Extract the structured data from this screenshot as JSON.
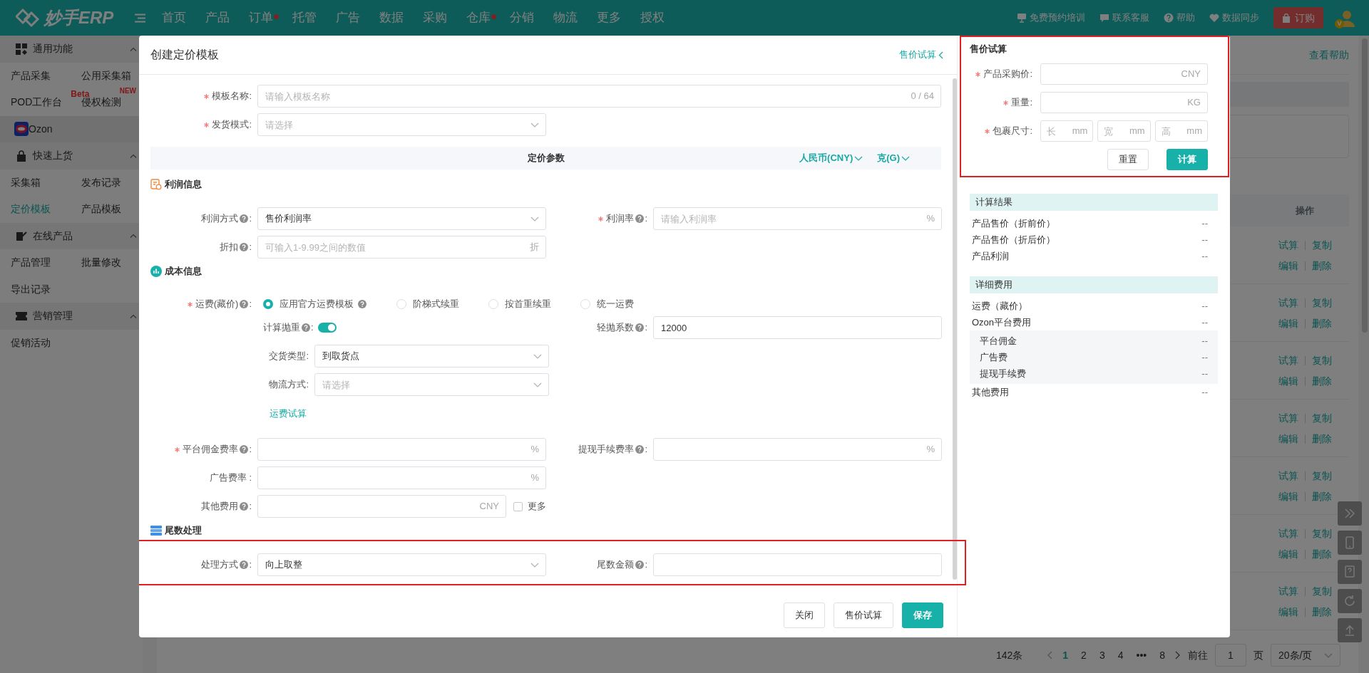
{
  "nav": {
    "logo": "妙手ERP",
    "items": [
      {
        "label": "首页",
        "dot": false
      },
      {
        "label": "产品",
        "dot": false
      },
      {
        "label": "订单",
        "dot": true
      },
      {
        "label": "托管",
        "dot": false
      },
      {
        "label": "广告",
        "dot": false
      },
      {
        "label": "数据",
        "dot": false
      },
      {
        "label": "采购",
        "dot": false
      },
      {
        "label": "仓库",
        "dot": true
      },
      {
        "label": "分销",
        "dot": false
      },
      {
        "label": "物流",
        "dot": false
      },
      {
        "label": "更多",
        "dot": false
      },
      {
        "label": "授权",
        "dot": false
      }
    ],
    "links": [
      "免费预约培训",
      "联系客服",
      "帮助",
      "数据同步"
    ],
    "order_button": "订购",
    "avatar_badge": "V"
  },
  "sidebar": {
    "sections": [
      {
        "kind": "group",
        "title": "通用功能",
        "expanded": true,
        "items": [
          {
            "label": "产品采集",
            "selected": false
          },
          {
            "label": "公用采集箱",
            "selected": false
          },
          {
            "label": "POD工作台",
            "badge": "Beta",
            "selected": false
          },
          {
            "label": "侵权检测",
            "badge": "NEW",
            "selected": false
          }
        ]
      },
      {
        "kind": "platform",
        "title": "Ozon"
      },
      {
        "kind": "group",
        "title": "快速上货",
        "expanded": true,
        "items": [
          {
            "label": "采集箱",
            "selected": false
          },
          {
            "label": "发布记录",
            "selected": false
          },
          {
            "label": "定价模板",
            "selected": true
          },
          {
            "label": "产品模板",
            "selected": false
          }
        ]
      },
      {
        "kind": "group",
        "title": "在线产品",
        "expanded": true,
        "items": [
          {
            "label": "产品管理",
            "selected": false
          },
          {
            "label": "批量修改",
            "selected": false
          },
          {
            "label": "导出记录",
            "selected": false
          }
        ]
      },
      {
        "kind": "group",
        "title": "营销管理",
        "expanded": true,
        "items": [
          {
            "label": "促销活动",
            "selected": false
          }
        ]
      }
    ]
  },
  "main": {
    "help_link": "查看帮助",
    "action_column": "操作",
    "rows": [
      {
        "actions": [
          "试算",
          "复制",
          "编辑",
          "删除"
        ]
      },
      {
        "actions": [
          "试算",
          "复制",
          "编辑",
          "删除"
        ]
      },
      {
        "actions": [
          "试算",
          "复制",
          "编辑",
          "删除"
        ]
      },
      {
        "actions": [
          "试算",
          "复制",
          "编辑",
          "删除"
        ]
      },
      {
        "actions": [
          "试算",
          "复制",
          "编辑",
          "删除"
        ]
      },
      {
        "actions": [
          "试算",
          "复制",
          "编辑",
          "删除"
        ]
      },
      {
        "actions": [
          "试算",
          "复制",
          "编辑",
          "删除"
        ]
      }
    ],
    "pagination": {
      "total": "142条",
      "pages": [
        {
          "label": "1",
          "selected": true
        },
        {
          "label": "2",
          "selected": false
        },
        {
          "label": "3",
          "selected": false
        },
        {
          "label": "4",
          "selected": false
        },
        {
          "label": "•••",
          "selected": false
        },
        {
          "label": "8",
          "selected": false
        }
      ],
      "goto_label": "前往",
      "goto_value": "1",
      "page_unit": "页",
      "page_size": "20条/页"
    }
  },
  "modal": {
    "title": "创建定价模板",
    "header_link": "售价试算",
    "rows": [
      {
        "kind": "wide",
        "fields": [
          {
            "label": "模板名称",
            "colon": ":",
            "required": true,
            "help": false,
            "kind": "input",
            "placeholder": "请输入模板名称",
            "counter": "0 / 64"
          }
        ]
      },
      {
        "kind": "pair",
        "fields": [
          {
            "label": "发货模式",
            "colon": ":",
            "required": true,
            "help": false,
            "kind": "select",
            "placeholder": "请选择"
          }
        ]
      },
      {
        "kind": "bar",
        "title": "定价参数",
        "units": [
          "人民币(CNY)",
          "克(G)"
        ]
      },
      {
        "kind": "section",
        "title": "利润信息"
      },
      {
        "kind": "pair",
        "fields": [
          {
            "label": "利润方式",
            "colon": ":",
            "required": false,
            "help": true,
            "kind": "select",
            "value": "售价利润率"
          },
          {
            "label": "利润率",
            "colon": ":",
            "required": true,
            "help": true,
            "kind": "input",
            "placeholder": "请输入利润率",
            "suffix": "%"
          }
        ]
      },
      {
        "kind": "pair",
        "fields": [
          {
            "label": "折扣",
            "colon": ":",
            "required": false,
            "help": true,
            "kind": "input",
            "placeholder": "可输入1-9.99之间的数值",
            "suffix": "折"
          }
        ]
      },
      {
        "kind": "section",
        "title": "成本信息"
      },
      {
        "kind": "radios",
        "label": "运费(藏价)",
        "colon": ":",
        "required": true,
        "help": true,
        "options": [
          {
            "label": "应用官方运费模板",
            "help": true,
            "selected": true
          },
          {
            "label": "阶梯式续重",
            "help": false,
            "selected": false
          },
          {
            "label": "按首重续重",
            "help": false,
            "selected": false
          },
          {
            "label": "统一运费",
            "help": false,
            "selected": false
          }
        ]
      },
      {
        "kind": "toggle",
        "toggle": {
          "label": "计算抛重",
          "colon": ":",
          "help": true,
          "on": true
        },
        "fields": [
          {
            "label": "轻抛系数",
            "colon": ":",
            "required": false,
            "help": true,
            "kind": "input",
            "value": "12000"
          }
        ]
      },
      {
        "kind": "sub",
        "fields": [
          {
            "label": "交货类型",
            "colon": ":",
            "required": false,
            "help": false,
            "kind": "select",
            "value": "到取货点"
          }
        ]
      },
      {
        "kind": "sub",
        "fields": [
          {
            "label": "物流方式",
            "colon": ":",
            "required": false,
            "help": false,
            "kind": "select",
            "placeholder": "请选择"
          }
        ]
      },
      {
        "kind": "link",
        "title": "运费试算"
      },
      {
        "kind": "pair",
        "fields": [
          {
            "label": "平台佣金费率",
            "colon": ":",
            "required": true,
            "help": true,
            "kind": "input",
            "suffix": "%"
          },
          {
            "label": "提现手续费率",
            "colon": ":",
            "required": false,
            "help": true,
            "kind": "input",
            "suffix": "%"
          }
        ]
      },
      {
        "kind": "pair",
        "fields": [
          {
            "label": "广告费率",
            "colon": " :",
            "required": false,
            "help": false,
            "kind": "input",
            "suffix": "%"
          }
        ]
      },
      {
        "kind": "pair",
        "fields": [
          {
            "label": "其他费用",
            "colon": ":",
            "required": false,
            "help": true,
            "kind": "input",
            "suffix": "CNY",
            "checkbox": {
              "label": "更多",
              "checked": false
            }
          }
        ]
      },
      {
        "kind": "section",
        "title": "尾数处理"
      },
      {
        "kind": "pair",
        "highlighted": true,
        "fields": [
          {
            "label": "处理方式",
            "colon": ":",
            "required": false,
            "help": true,
            "kind": "select",
            "value": "向上取整"
          },
          {
            "label": "尾数金额",
            "colon": ":",
            "required": false,
            "help": true,
            "kind": "input"
          }
        ]
      }
    ],
    "buttons": [
      {
        "label": "关闭",
        "kind": "default"
      },
      {
        "label": "售价试算",
        "kind": "default"
      },
      {
        "label": "保存",
        "kind": "primary"
      }
    ],
    "calculator": {
      "title": "售价试算",
      "highlighted": true,
      "fields": [
        {
          "label": "产品采购价",
          "colon": ":",
          "required": true,
          "suffix": "CNY"
        },
        {
          "label": "重量",
          "colon": ":",
          "required": true,
          "suffix": "KG"
        }
      ],
      "size": {
        "label": "包裹尺寸",
        "colon": ":",
        "required": true,
        "parts": [
          {
            "placeholder": "长",
            "suffix": "mm"
          },
          {
            "placeholder": "宽",
            "suffix": "mm"
          },
          {
            "placeholder": "高",
            "suffix": "mm"
          }
        ]
      },
      "buttons": [
        {
          "label": "重置",
          "kind": "default"
        },
        {
          "label": "计算",
          "kind": "primary"
        }
      ]
    },
    "results": [
      {
        "title": "计算结果",
        "rows": [
          {
            "label": "产品售价（折前价）",
            "value": "--"
          },
          {
            "label": "产品售价（折后价）",
            "value": "--"
          },
          {
            "label": "产品利润",
            "value": "--"
          }
        ]
      },
      {
        "title": "详细费用",
        "rows": [
          {
            "label": "运费（藏价）",
            "value": "--"
          },
          {
            "label": "Ozon平台费用",
            "value": "--",
            "children": [
              {
                "label": "平台佣金",
                "value": "--"
              },
              {
                "label": "广告费",
                "value": "--"
              },
              {
                "label": "提现手续费",
                "value": "--"
              }
            ]
          },
          {
            "label": "其他费用",
            "value": "--"
          }
        ]
      }
    ]
  }
}
